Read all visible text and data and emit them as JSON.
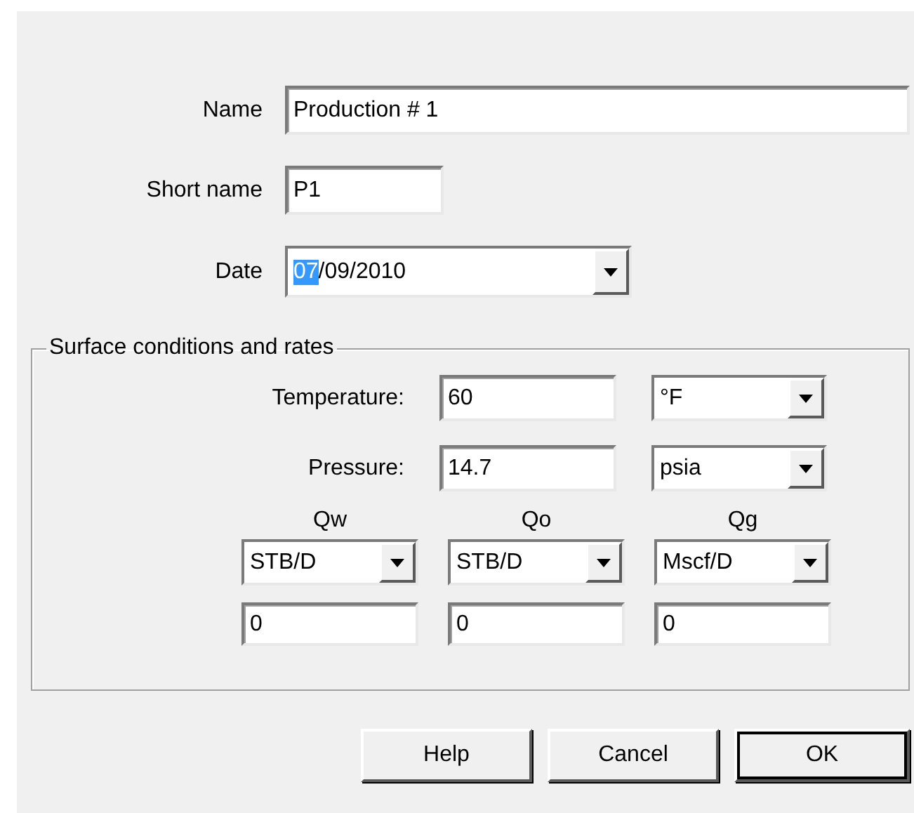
{
  "fields": [
    {
      "label": "Name",
      "value": "Production # 1",
      "kind": "wide"
    },
    {
      "label": "Short name",
      "value": "P1",
      "kind": "short"
    },
    {
      "label": "Date",
      "kind": "date",
      "parts": [
        {
          "text": "07",
          "selected": true
        },
        {
          "text": "/09/2010",
          "selected": false
        }
      ]
    }
  ],
  "group": {
    "title": "Surface conditions and rates",
    "conditions": [
      {
        "label": "Temperature:",
        "value": "60",
        "unit": "°F"
      },
      {
        "label": "Pressure:",
        "value": "14.7",
        "unit": "psia"
      }
    ],
    "rates": [
      {
        "label": "Qw",
        "unit": "STB/D",
        "value": "0"
      },
      {
        "label": "Qo",
        "unit": "STB/D",
        "value": "0"
      },
      {
        "label": "Qg",
        "unit": "Mscf/D",
        "value": "0"
      }
    ]
  },
  "buttons": [
    {
      "label": "Help",
      "default": false
    },
    {
      "label": "Cancel",
      "default": false
    },
    {
      "label": "OK",
      "default": true
    }
  ]
}
